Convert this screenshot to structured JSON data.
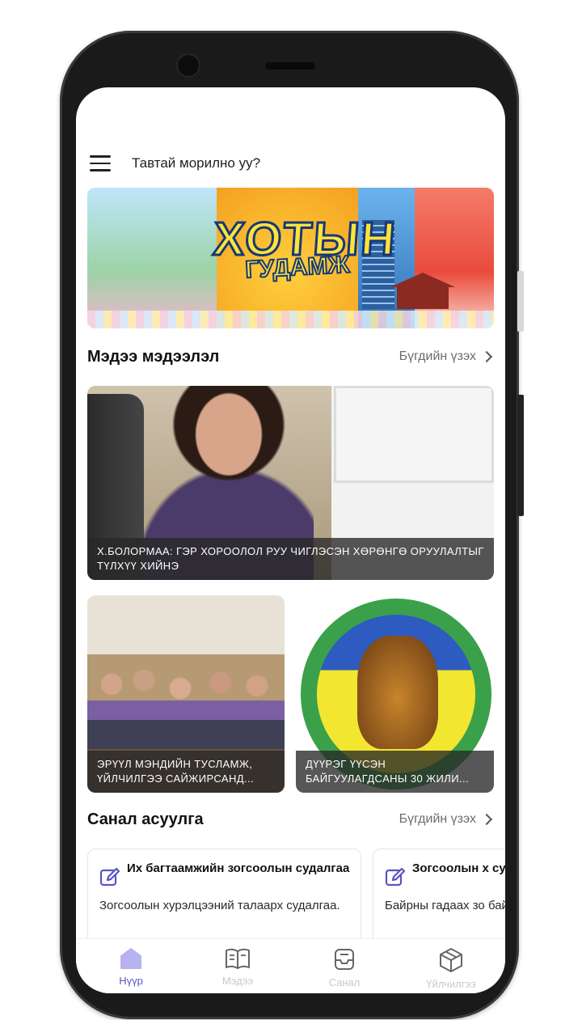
{
  "app": {
    "title": "Тавтай морилно уу?"
  },
  "banner": {
    "word1": "ХОТЫН",
    "word2": "ГУДАМЖ"
  },
  "news": {
    "section_title": "Мэдээ мэдээлэл",
    "see_all": "Бүгдийн үзэх",
    "items": [
      {
        "caption": "Х.БОЛОРМАА: ГЭР ХОРООЛОЛ РУУ ЧИГЛЭСЭН ХӨРӨНГӨ ОРУУЛАЛТЫГ ТҮЛХҮҮ ХИЙНЭ"
      },
      {
        "caption": "ЭРҮҮЛ МЭНДИЙН ТУСЛАМЖ, ҮЙЛЧИЛГЭЭ САЙЖИРСАНД..."
      },
      {
        "caption": "ДҮҮРЭГ ҮҮСЭН БАЙГУУЛАГДСАНЫ 30 ЖИЛИ..."
      }
    ]
  },
  "surveys": {
    "section_title": "Санал асуулга",
    "see_all": "Бүгдийн үзэх",
    "items": [
      {
        "title": "Их багтаамжийн зогсоолын судалгаа",
        "description": "Зогсоолын хурэлцээний талаарх судалгаа."
      },
      {
        "title": "Зогсоолын х судалгаа",
        "description": "Байрны гадаах зо байгаа тул."
      }
    ]
  },
  "nav": {
    "items": [
      {
        "label": "Нүүр",
        "icon": "home-icon",
        "active": true
      },
      {
        "label": "Мэдээ",
        "icon": "book-icon",
        "active": false
      },
      {
        "label": "Санал",
        "icon": "inbox-icon",
        "active": false
      },
      {
        "label": "Үйлчилгээ",
        "icon": "box-icon",
        "active": false
      }
    ]
  },
  "colors": {
    "accent": "#5a54c4",
    "accent_light": "#b7b3f0",
    "text": "#111111",
    "muted": "#6c6c6c"
  }
}
